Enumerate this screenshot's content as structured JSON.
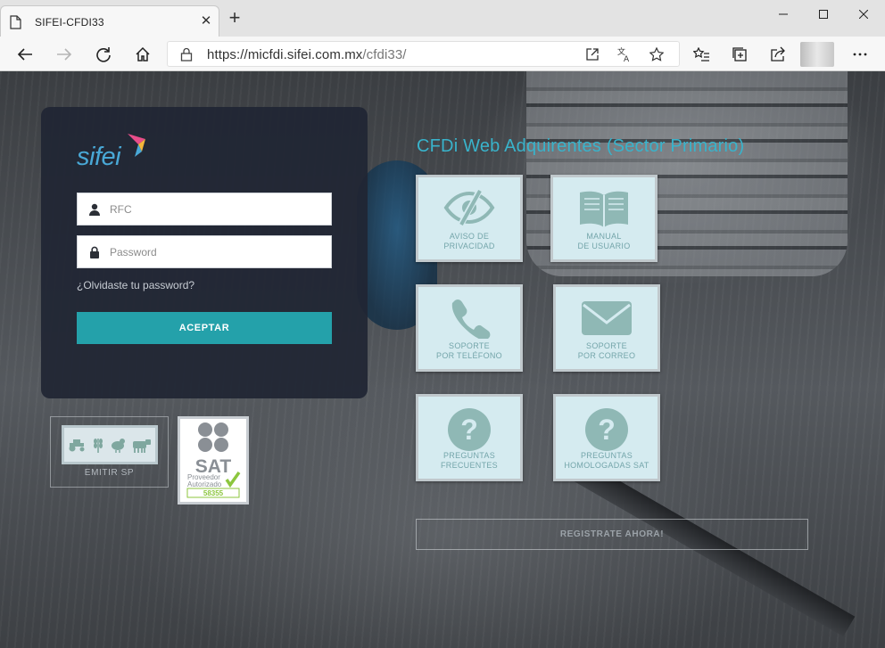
{
  "browser": {
    "tab_title": "SIFEI-CFDI33",
    "url": "https://micfdi.sifei.com.mx/cfdi33/",
    "url_host": "https://micfdi.sifei.com.mx",
    "url_path": "/cfdi33/",
    "icons": [
      "page-icon",
      "close-icon",
      "plus-icon",
      "minimize-icon",
      "maximize-icon",
      "window-close-icon",
      "back-arrow-icon",
      "forward-arrow-icon",
      "refresh-icon",
      "home-icon",
      "lock-icon",
      "open-external-icon",
      "translate-icon",
      "favorite-star-icon",
      "favorites-list-icon",
      "collections-icon",
      "share-icon",
      "more-dots-icon"
    ]
  },
  "login": {
    "logo_text": "sifei",
    "rfc_placeholder": "RFC",
    "password_placeholder": "Password",
    "forgot_label": "¿Olvidaste tu password?",
    "accept_label": "ACEPTAR"
  },
  "badges": {
    "emitir_label": "EMITIR SP",
    "sat": {
      "title": "SAT",
      "line1": "Proveedor",
      "line2": "Autorizado",
      "number": "58355"
    }
  },
  "main": {
    "heading": "CFDi Web Adquirentes (Sector Primario)",
    "tiles": [
      {
        "line1": "AVISO DE",
        "line2": "PRIVACIDAD",
        "icon": "eye-slash-icon"
      },
      {
        "line1": "MANUAL",
        "line2": "DE USUARIO",
        "icon": "book-icon"
      },
      {
        "line1": "SOPORTE",
        "line2": "POR TELÉFONO",
        "icon": "phone-icon"
      },
      {
        "line1": "SOPORTE",
        "line2": "POR CORREO",
        "icon": "envelope-icon"
      },
      {
        "line1": "PREGUNTAS",
        "line2": "FRECUENTES",
        "icon": "question-icon"
      },
      {
        "line1": "PREGUNTAS",
        "line2": "HOMOLOGADAS SAT",
        "icon": "question-icon"
      }
    ],
    "register_label": "REGISTRATE AHORA!"
  },
  "colors": {
    "accent": "#24a1aa",
    "heading": "#39b3cb",
    "tile_bg": "#d5ebf0",
    "tile_icon": "#8fb8b5",
    "panel_bg": "#202634"
  }
}
